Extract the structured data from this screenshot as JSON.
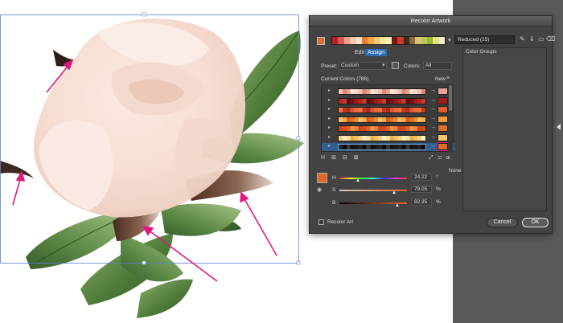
{
  "dialog": {
    "title": "Recolor Artwork",
    "harmony_name": "Reduced (25)",
    "tabs": [
      "Edit",
      "Assign"
    ],
    "active_tab": "Assign",
    "preset_label": "Preset:",
    "preset_value": "Custom",
    "colors_label": "Colors:",
    "colors_value": "All",
    "current_colors_label": "Current Colors (786)",
    "new_label": "New",
    "color_groups_label": "Color Groups",
    "none_label": "None",
    "hsb": {
      "h_label": "H",
      "h_value": "24.22",
      "h_unit": "°",
      "s_label": "S",
      "s_value": "79.05",
      "s_unit": "%",
      "b_label": "B",
      "b_value": "82.35",
      "b_unit": "%"
    },
    "recolor_art_label": "Recolor Art",
    "cancel_label": "Cancel",
    "ok_label": "OK",
    "active_color": "#e06a28",
    "harmony_colors": [
      "#b9201e",
      "#d9595a",
      "#f0a08a",
      "#f7c7b4",
      "#fbe2cf",
      "#e87c2a",
      "#f2a64a",
      "#f6c86b",
      "#f7e39a",
      "#f5f0b0",
      "#7a1414",
      "#c93a2a",
      "#3a2a1a",
      "#8c6a3a",
      "#d8c27a",
      "#b8c84a",
      "#9ab63a",
      "#e8e07a",
      "#f0ead0"
    ],
    "rows": [
      {
        "id": "row-1",
        "new_color": "#e9a295",
        "selected": false
      },
      {
        "id": "row-2",
        "new_color": "#9d1c17",
        "selected": false
      },
      {
        "id": "row-3",
        "new_color": "#e35e2e",
        "selected": false
      },
      {
        "id": "row-4",
        "new_color": "#f09a3a",
        "selected": false
      },
      {
        "id": "row-5",
        "new_color": "#e07030",
        "selected": false
      },
      {
        "id": "row-6",
        "new_color": "#f6c66a",
        "selected": false
      },
      {
        "id": "row-7",
        "new_color": "#e06a28",
        "selected": true
      }
    ]
  }
}
